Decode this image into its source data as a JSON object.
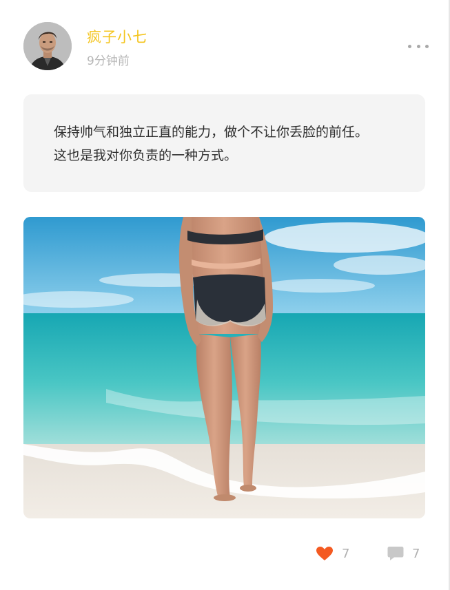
{
  "post": {
    "author": {
      "name": "疯子小七",
      "avatar_icon": "user-avatar"
    },
    "time_ago": "9分钟前",
    "text_lines": [
      "保持帅气和独立正直的能力，做个不让你丢脸的前任。",
      "这也是我对你负责的一种方式。"
    ],
    "image": {
      "description_icon": "beach-photo"
    },
    "actions": {
      "like_count": "7",
      "comment_count": "7",
      "like_color": "#f45a21",
      "comment_color": "#c8c8c8"
    }
  },
  "colors": {
    "username": "#f4c51f",
    "timestamp": "#b6b6b6",
    "text_box_bg": "#f4f4f4"
  }
}
